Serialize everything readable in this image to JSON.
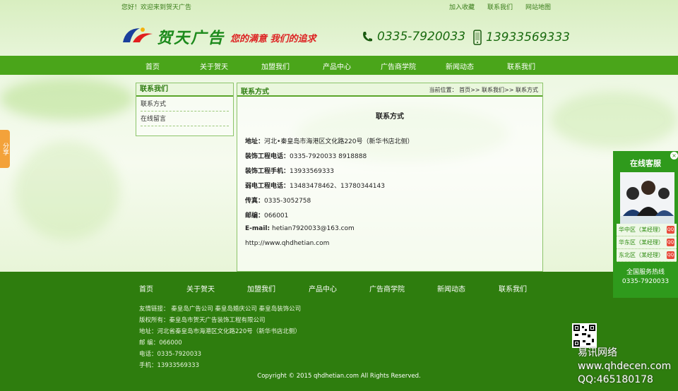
{
  "topbar": {
    "welcome": "您好！欢迎来到贺天广告",
    "links": [
      "加入收藏",
      "联系我们",
      "网站地图"
    ]
  },
  "header": {
    "brand": "贺天广告",
    "slogan": "您的满意  我们的追求",
    "phone": "0335-7920033",
    "mobile": "13933569333"
  },
  "nav": [
    "首页",
    "关于贺天",
    "加盟我们",
    "产品中心",
    "广告商学院",
    "新闻动态",
    "联系我们"
  ],
  "sidebar": {
    "title": "联系我们",
    "items": [
      "联系方式",
      "在线留言"
    ]
  },
  "main": {
    "title": "联系方式",
    "breadcrumb": "当前位置： 首页>> 联系我们>> 联系方式",
    "article_title": "联系方式",
    "lines": [
      {
        "label": "地址：",
        "value": "河北•秦皇岛市海港区文化路220号（新华书店北侧）"
      },
      {
        "label": "装饰工程电话：",
        "value": "0335-7920033 8918888"
      },
      {
        "label": "装饰工程手机：",
        "value": "13933569333"
      },
      {
        "label": "弱电工程电话：",
        "value": "13483478462、13780344143"
      },
      {
        "label": "传真：",
        "value": "0335-3052758"
      },
      {
        "label": "邮编：",
        "value": "066001"
      },
      {
        "label": "E-mail:",
        "value": "hetian7920033@163.com"
      },
      {
        "label": "",
        "value": "http://www.qhdhetian.com"
      }
    ]
  },
  "footer": {
    "nav": [
      "首页",
      "关于贺天",
      "加盟我们",
      "产品中心",
      "广告商学院",
      "新闻动态",
      "联系我们"
    ],
    "friend_links": "友情链接：  秦皇岛广告公司    秦皇岛婚庆公司    秦皇岛装饰公司",
    "copyright_owner": "版权所有：秦皇岛市贺天广告装饰工程有限公司",
    "address": "地址：河北省秦皇岛市海港区文化路220号（新华书店北侧）",
    "postcode": "邮 编：066000",
    "phone": "电话：0335-7920033",
    "mobile": "手机：13933569333",
    "copyright": "Copyright © 2015 qhdhetian.com All Rights Reserved."
  },
  "share_tab": "分享",
  "service": {
    "title": "在线客服",
    "close": "×",
    "agents": [
      "华中区（某经理）",
      "华东区（某经理）",
      "东北区（某经理）"
    ],
    "hotline_label": "全国服务热线",
    "hotline": "0335-7920033"
  },
  "watermark": {
    "line1": "易讯网络",
    "line2": "www.qhdecen.com",
    "line3": "QQ:465180178"
  },
  "colors": {
    "nav": "#4aa51a",
    "footer": "#2e7d0e",
    "service": "#2f9a1c",
    "accent_text": "#2f7d12"
  }
}
